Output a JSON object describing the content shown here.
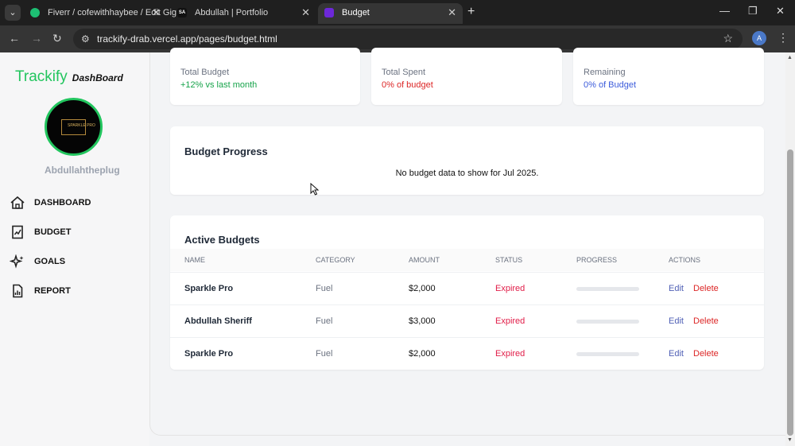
{
  "browser": {
    "tabs": [
      {
        "title": "Fiverr / cofewithhaybee / Edit Gig",
        "favicon_color": "#1dbf73"
      },
      {
        "title": "Abdullah | Portfolio",
        "favicon_text": "SA",
        "favicon_color": "#111111"
      },
      {
        "title": "Budget",
        "favicon_color": "#6d28d9"
      }
    ],
    "url": "trackify-drab.vercel.app/pages/budget.html",
    "profile_initial": "A"
  },
  "sidebar": {
    "brand": "Trackify",
    "brand_sub": "DashBoard",
    "brand_color": "#22c55e",
    "avatar_text": "SPARKLE PRO",
    "username": "Abdullahtheplug",
    "items": [
      {
        "label": "DASHBOARD",
        "icon": "home-icon"
      },
      {
        "label": "BUDGET",
        "icon": "budget-icon"
      },
      {
        "label": "GOALS",
        "icon": "goals-icon"
      },
      {
        "label": "REPORT",
        "icon": "report-icon"
      }
    ]
  },
  "stats": [
    {
      "label": "Total Budget",
      "sub": "+12% vs last month",
      "color": "#16a34a"
    },
    {
      "label": "Total Spent",
      "sub": "0% of budget",
      "color": "#dc2626"
    },
    {
      "label": "Remaining",
      "sub": "0% of Budget",
      "color": "#3b5bdb"
    }
  ],
  "progress_section": {
    "title": "Budget Progress",
    "empty_message": "No budget data to show for Jul 2025."
  },
  "active_budgets": {
    "title": "Active Budgets",
    "columns": [
      "NAME",
      "CATEGORY",
      "AMOUNT",
      "STATUS",
      "PROGRESS",
      "ACTIONS"
    ],
    "rows": [
      {
        "name": "Sparkle Pro",
        "category": "Fuel",
        "amount": "$2,000",
        "status": "Expired",
        "progress": 0,
        "edit": "Edit",
        "delete": "Delete"
      },
      {
        "name": "Abdullah Sheriff",
        "category": "Fuel",
        "amount": "$3,000",
        "status": "Expired",
        "progress": 0,
        "edit": "Edit",
        "delete": "Delete"
      },
      {
        "name": "Sparkle Pro",
        "category": "Fuel",
        "amount": "$2,000",
        "status": "Expired",
        "progress": 0,
        "edit": "Edit",
        "delete": "Delete"
      }
    ]
  }
}
